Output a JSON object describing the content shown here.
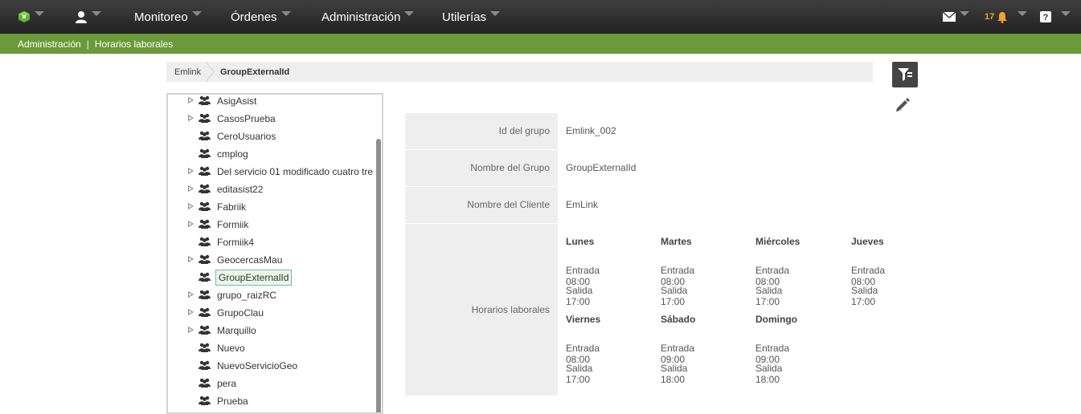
{
  "topbar": {
    "menu": [
      {
        "label": "Monitoreo"
      },
      {
        "label": "Órdenes"
      },
      {
        "label": "Administración"
      },
      {
        "label": "Utilerías"
      }
    ],
    "notifications_count": "17"
  },
  "green_breadcrumb": {
    "section": "Administración",
    "page": "Horarios laborales"
  },
  "path": {
    "root": "Emlink",
    "current": "GroupExternalId"
  },
  "tree": {
    "items": [
      {
        "label": "AsigAsist",
        "expandable": true
      },
      {
        "label": "CasosPrueba",
        "expandable": true
      },
      {
        "label": "CeroUsuarios",
        "expandable": false
      },
      {
        "label": "cmplog",
        "expandable": false
      },
      {
        "label": "Del servicio 01 modificado cuatro tre",
        "expandable": true
      },
      {
        "label": "editasist22",
        "expandable": true
      },
      {
        "label": "Fabriik",
        "expandable": true
      },
      {
        "label": "Formiik",
        "expandable": true
      },
      {
        "label": "Formiik4",
        "expandable": false
      },
      {
        "label": "GeocercasMau",
        "expandable": true
      },
      {
        "label": "GroupExternalId",
        "expandable": false,
        "selected": true
      },
      {
        "label": "grupo_raizRC",
        "expandable": true
      },
      {
        "label": "GrupoClau",
        "expandable": true
      },
      {
        "label": "Marquillo",
        "expandable": true
      },
      {
        "label": "Nuevo",
        "expandable": false
      },
      {
        "label": "NuevoServicioGeo",
        "expandable": false
      },
      {
        "label": "pera",
        "expandable": false
      },
      {
        "label": "Prueba",
        "expandable": false
      }
    ]
  },
  "detail": {
    "group_id_label": "Id del grupo",
    "group_id_value": "Emlink_002",
    "group_name_label": "Nombre del Grupo",
    "group_name_value": "GroupExternalId",
    "client_name_label": "Nombre del Cliente",
    "client_name_value": "EmLink",
    "schedule_label": "Horarios laborales",
    "schedule": [
      {
        "day": "Lunes",
        "in": "Entrada 08:00",
        "out": "Salida 17:00"
      },
      {
        "day": "Martes",
        "in": "Entrada 08:00",
        "out": "Salida 17:00"
      },
      {
        "day": "Miércoles",
        "in": "Entrada 08:00",
        "out": "Salida 17:00"
      },
      {
        "day": "Jueves",
        "in": "Entrada 08:00",
        "out": "Salida 17:00"
      },
      {
        "day": "Viernes",
        "in": "Entrada 08:00",
        "out": "Salida 17:00"
      },
      {
        "day": "Sábado",
        "in": "Entrada 09:00",
        "out": "Salida 18:00"
      },
      {
        "day": "Domingo",
        "in": "Entrada 09:00",
        "out": "Salida 18:00"
      }
    ]
  },
  "colors": {
    "topbar": "#2e2e2e",
    "greenbar": "#6a9a3a",
    "notification": "#f0a030",
    "label_bg": "#eeeeee"
  },
  "icons": {
    "logo": "cube-logo-icon",
    "user": "user-icon",
    "mail": "mail-icon",
    "bell": "bell-icon",
    "help": "help-icon",
    "filter": "filter-icon",
    "edit": "pencil-icon",
    "group": "group-icon"
  }
}
